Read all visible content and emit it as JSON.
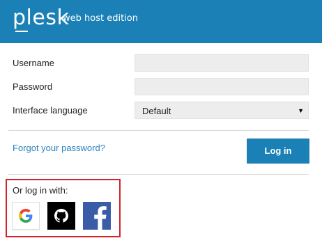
{
  "header": {
    "logo": "plesk",
    "edition": "web host edition",
    "background": "#1a80b6"
  },
  "form": {
    "username_label": "Username",
    "username_value": "",
    "password_label": "Password",
    "password_value": "",
    "language_label": "Interface language",
    "language_value": "Default"
  },
  "actions": {
    "forgot_label": "Forgot your password?",
    "login_label": "Log in"
  },
  "social": {
    "label": "Or log in with:",
    "providers": [
      "google-icon",
      "github-icon",
      "facebook-icon"
    ],
    "highlight_color": "#d6202a"
  }
}
